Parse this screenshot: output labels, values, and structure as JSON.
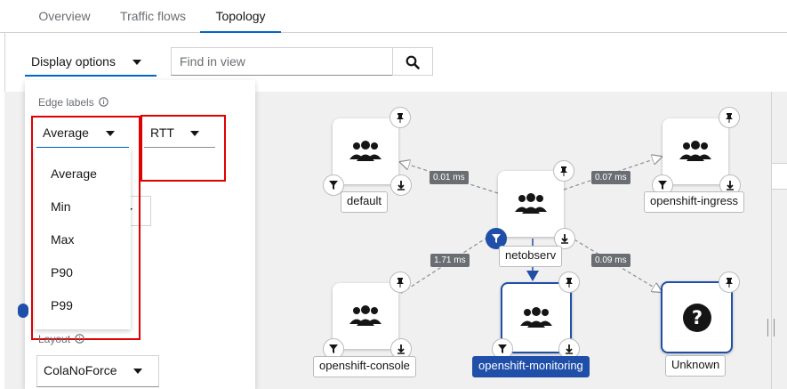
{
  "tabs": [
    {
      "label": "Overview",
      "active": false
    },
    {
      "label": "Traffic flows",
      "active": false
    },
    {
      "label": "Topology",
      "active": true
    }
  ],
  "toolbar": {
    "display_options_label": "Display options",
    "find_placeholder": "Find in view"
  },
  "display_panel": {
    "edge_labels_title": "Edge labels",
    "metric_function": {
      "selected": "Average",
      "options": [
        "Average",
        "Min",
        "Max",
        "P90",
        "P99"
      ]
    },
    "metric_type": {
      "selected": "RTT"
    },
    "layout_title": "Layout",
    "layout_select": {
      "selected": "ColaNoForce"
    }
  },
  "topology": {
    "nodes": [
      {
        "id": "default",
        "label": "default",
        "icon": "users-icon",
        "selected": false
      },
      {
        "id": "netobserv",
        "label": "netobserv",
        "icon": "users-icon",
        "selected": false,
        "filtered": true
      },
      {
        "id": "openshift-ingress",
        "label": "openshift-ingress",
        "icon": "users-icon",
        "selected": false
      },
      {
        "id": "openshift-console",
        "label": "openshift-console",
        "icon": "users-icon",
        "selected": false
      },
      {
        "id": "openshift-monitoring",
        "label": "openshift-monitoring",
        "icon": "users-icon",
        "selected": true
      },
      {
        "id": "unknown",
        "label": "Unknown",
        "icon": "question-icon",
        "selected": false
      }
    ],
    "edges": [
      {
        "from": "netobserv",
        "to": "default",
        "label": "0.01 ms"
      },
      {
        "from": "netobserv",
        "to": "openshift-ingress",
        "label": "0.07 ms"
      },
      {
        "from": "netobserv",
        "to": "openshift-console",
        "label": "1.71 ms"
      },
      {
        "from": "netobserv",
        "to": "unknown",
        "label": "0.09 ms"
      },
      {
        "from": "netobserv",
        "to": "openshift-monitoring",
        "label": ""
      }
    ]
  },
  "colors": {
    "accent": "#0066cc",
    "selected": "#1f4fa8",
    "highlight": "#e00000",
    "canvas": "#f0f0f0"
  }
}
